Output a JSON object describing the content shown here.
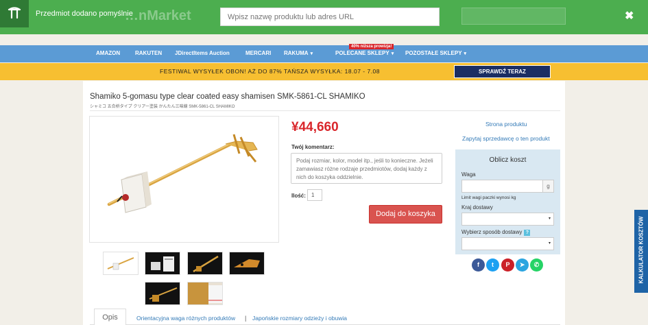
{
  "notification": {
    "message": "Przedmiot dodano pomyślnie",
    "close_glyph": "✖",
    "search_placeholder": "Wpisz nazwę produktu lub adres URL",
    "ghost_brand": "…nMarket"
  },
  "nav": {
    "items": [
      {
        "label": "AMAZON",
        "dropdown": false
      },
      {
        "label": "RAKUTEN",
        "dropdown": false
      },
      {
        "label": "JDirectItems Auction",
        "dropdown": false
      },
      {
        "label": "MERCARI",
        "dropdown": false
      },
      {
        "label": "RAKUMA",
        "dropdown": true
      },
      {
        "label": "POLECANE SKLEPY",
        "dropdown": true
      },
      {
        "label": "POZOSTAŁE SKLEPY",
        "dropdown": true
      }
    ],
    "promo_tag": "40% niższa prowizja!",
    "caret": "▾"
  },
  "banner": {
    "text": "FESTIWAL WYSYŁEK OBON! AŻ DO 87% TAŃSZA WYSYŁKA: 18.07 - 7.08",
    "button": "SPRAWDŹ TERAZ"
  },
  "product": {
    "title": "Shamiko 5-gomasu type clear coated easy shamisen SMK-5861-CL SHAMIKO",
    "subtitle": "シャミコ 五合枡タイプ クリアー塗装 かんたん三味線 SMK-5861-CL SHAMIKO",
    "price": "¥44,660",
    "comment_label": "Twój komentarz:",
    "comment_placeholder": "Podaj rozmiar, kolor, model itp., jeśli to konieczne. Jeżeli zamawiasz różne rodzaje przedmiotów, dodaj każdy z nich do koszyka oddzielnie.",
    "qty_label": "Ilość:",
    "qty_value": "1",
    "add_to_cart": "Dodaj do koszyka"
  },
  "links": {
    "product_page": "Strona produktu",
    "ask_seller": "Zapytaj sprzedawcę o ten produkt"
  },
  "calculator": {
    "title": "Oblicz koszt",
    "weight_label": "Waga",
    "weight_unit": "g",
    "weight_note": "Limit wagi paczki wynosi kg",
    "country_label": "Kraj dostawy",
    "method_label": "Wybierz sposób dostawy",
    "help_glyph": "?",
    "side_tab": "KALKULATOR KOSZTÓW"
  },
  "social": [
    {
      "icon": "facebook-icon",
      "glyph": "f",
      "color": "#3b5998"
    },
    {
      "icon": "twitter-icon",
      "glyph": "t",
      "color": "#1da1f2"
    },
    {
      "icon": "pinterest-icon",
      "glyph": "P",
      "color": "#cb2027"
    },
    {
      "icon": "telegram-icon",
      "glyph": "➤",
      "color": "#2ca5e0"
    },
    {
      "icon": "whatsapp-icon",
      "glyph": "✆",
      "color": "#25d366"
    }
  ],
  "tabs": {
    "active": "Opis",
    "weights": "Orientacyjna waga różnych produktów",
    "separator": "|",
    "sizes": "Japońskie rozmiary odzieży i obuwia"
  },
  "colors": {
    "notify": "#4cae4f",
    "nav": "#5b9bd5",
    "banner": "#f7bf31",
    "price": "#d9262b",
    "cart_button": "#d9534f",
    "side_tab": "#1e63a6"
  }
}
